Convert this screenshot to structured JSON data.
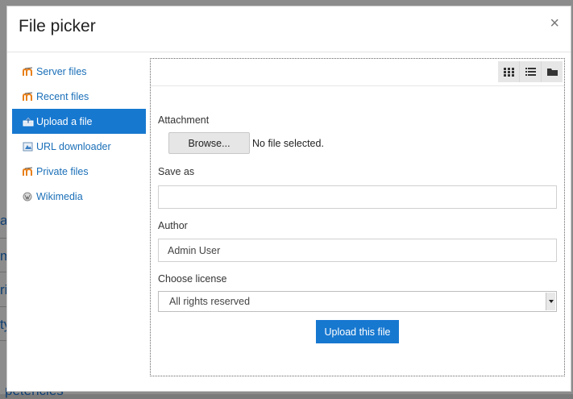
{
  "background": {
    "fragments": [
      "a",
      "m",
      "ric",
      "ty",
      "petencies"
    ],
    "right_fragments": [
      "e",
      "ne"
    ]
  },
  "dialog": {
    "title": "File picker",
    "close_symbol": "×"
  },
  "sidebar": {
    "items": [
      {
        "label": "Server files",
        "icon": "repository-icon",
        "active": false
      },
      {
        "label": "Recent files",
        "icon": "repository-icon",
        "active": false
      },
      {
        "label": "Upload a file",
        "icon": "upload-icon",
        "active": true
      },
      {
        "label": "URL downloader",
        "icon": "url-icon",
        "active": false
      },
      {
        "label": "Private files",
        "icon": "repository-icon",
        "active": false
      },
      {
        "label": "Wikimedia",
        "icon": "wikimedia-icon",
        "active": false
      }
    ]
  },
  "toolbar": {
    "views": [
      "icons-view-icon",
      "list-view-icon",
      "folder-view-icon"
    ]
  },
  "form": {
    "attachment_label": "Attachment",
    "browse_label": "Browse...",
    "no_file_text": "No file selected.",
    "save_as_label": "Save as",
    "save_as_value": "",
    "author_label": "Author",
    "author_value": "Admin User",
    "license_label": "Choose license",
    "license_value": "All rights reserved",
    "submit_label": "Upload this file"
  },
  "colors": {
    "accent": "#1778d0",
    "link": "#1a6fb8",
    "overlay": "#8c8c8c"
  }
}
